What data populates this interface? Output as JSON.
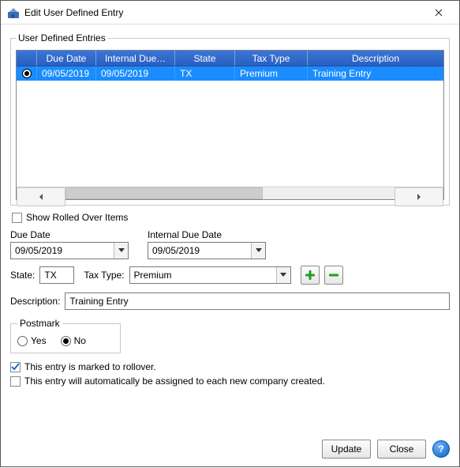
{
  "window": {
    "title": "Edit User Defined Entry"
  },
  "grid": {
    "legend": "User Defined Entries",
    "columns": {
      "sel": "",
      "due": "Due Date",
      "internal": "Internal Due…",
      "state": "State",
      "tax": "Tax Type",
      "desc": "Description"
    },
    "rows": [
      {
        "selected": true,
        "due": "09/05/2019",
        "internal": "09/05/2019",
        "state": "TX",
        "tax": "Premium",
        "desc": "Training Entry"
      }
    ]
  },
  "showRolled": {
    "label": "Show Rolled Over Items",
    "checked": false
  },
  "dueDate": {
    "label": "Due Date",
    "value": "09/05/2019"
  },
  "internalDue": {
    "label": "Internal Due Date",
    "value": "09/05/2019"
  },
  "state": {
    "label": "State:",
    "value": "TX"
  },
  "taxType": {
    "label": "Tax Type:",
    "value": "Premium"
  },
  "description": {
    "label": "Description:",
    "value": "Training Entry"
  },
  "postmark": {
    "legend": "Postmark",
    "yes": "Yes",
    "no": "No",
    "value": "No"
  },
  "rollover": {
    "label": "This entry is marked to rollover.",
    "checked": true
  },
  "autoAssign": {
    "label": "This entry will automatically be assigned to each new company created.",
    "checked": false
  },
  "buttons": {
    "update": "Update",
    "close": "Close"
  },
  "help": {
    "symbol": "?"
  }
}
